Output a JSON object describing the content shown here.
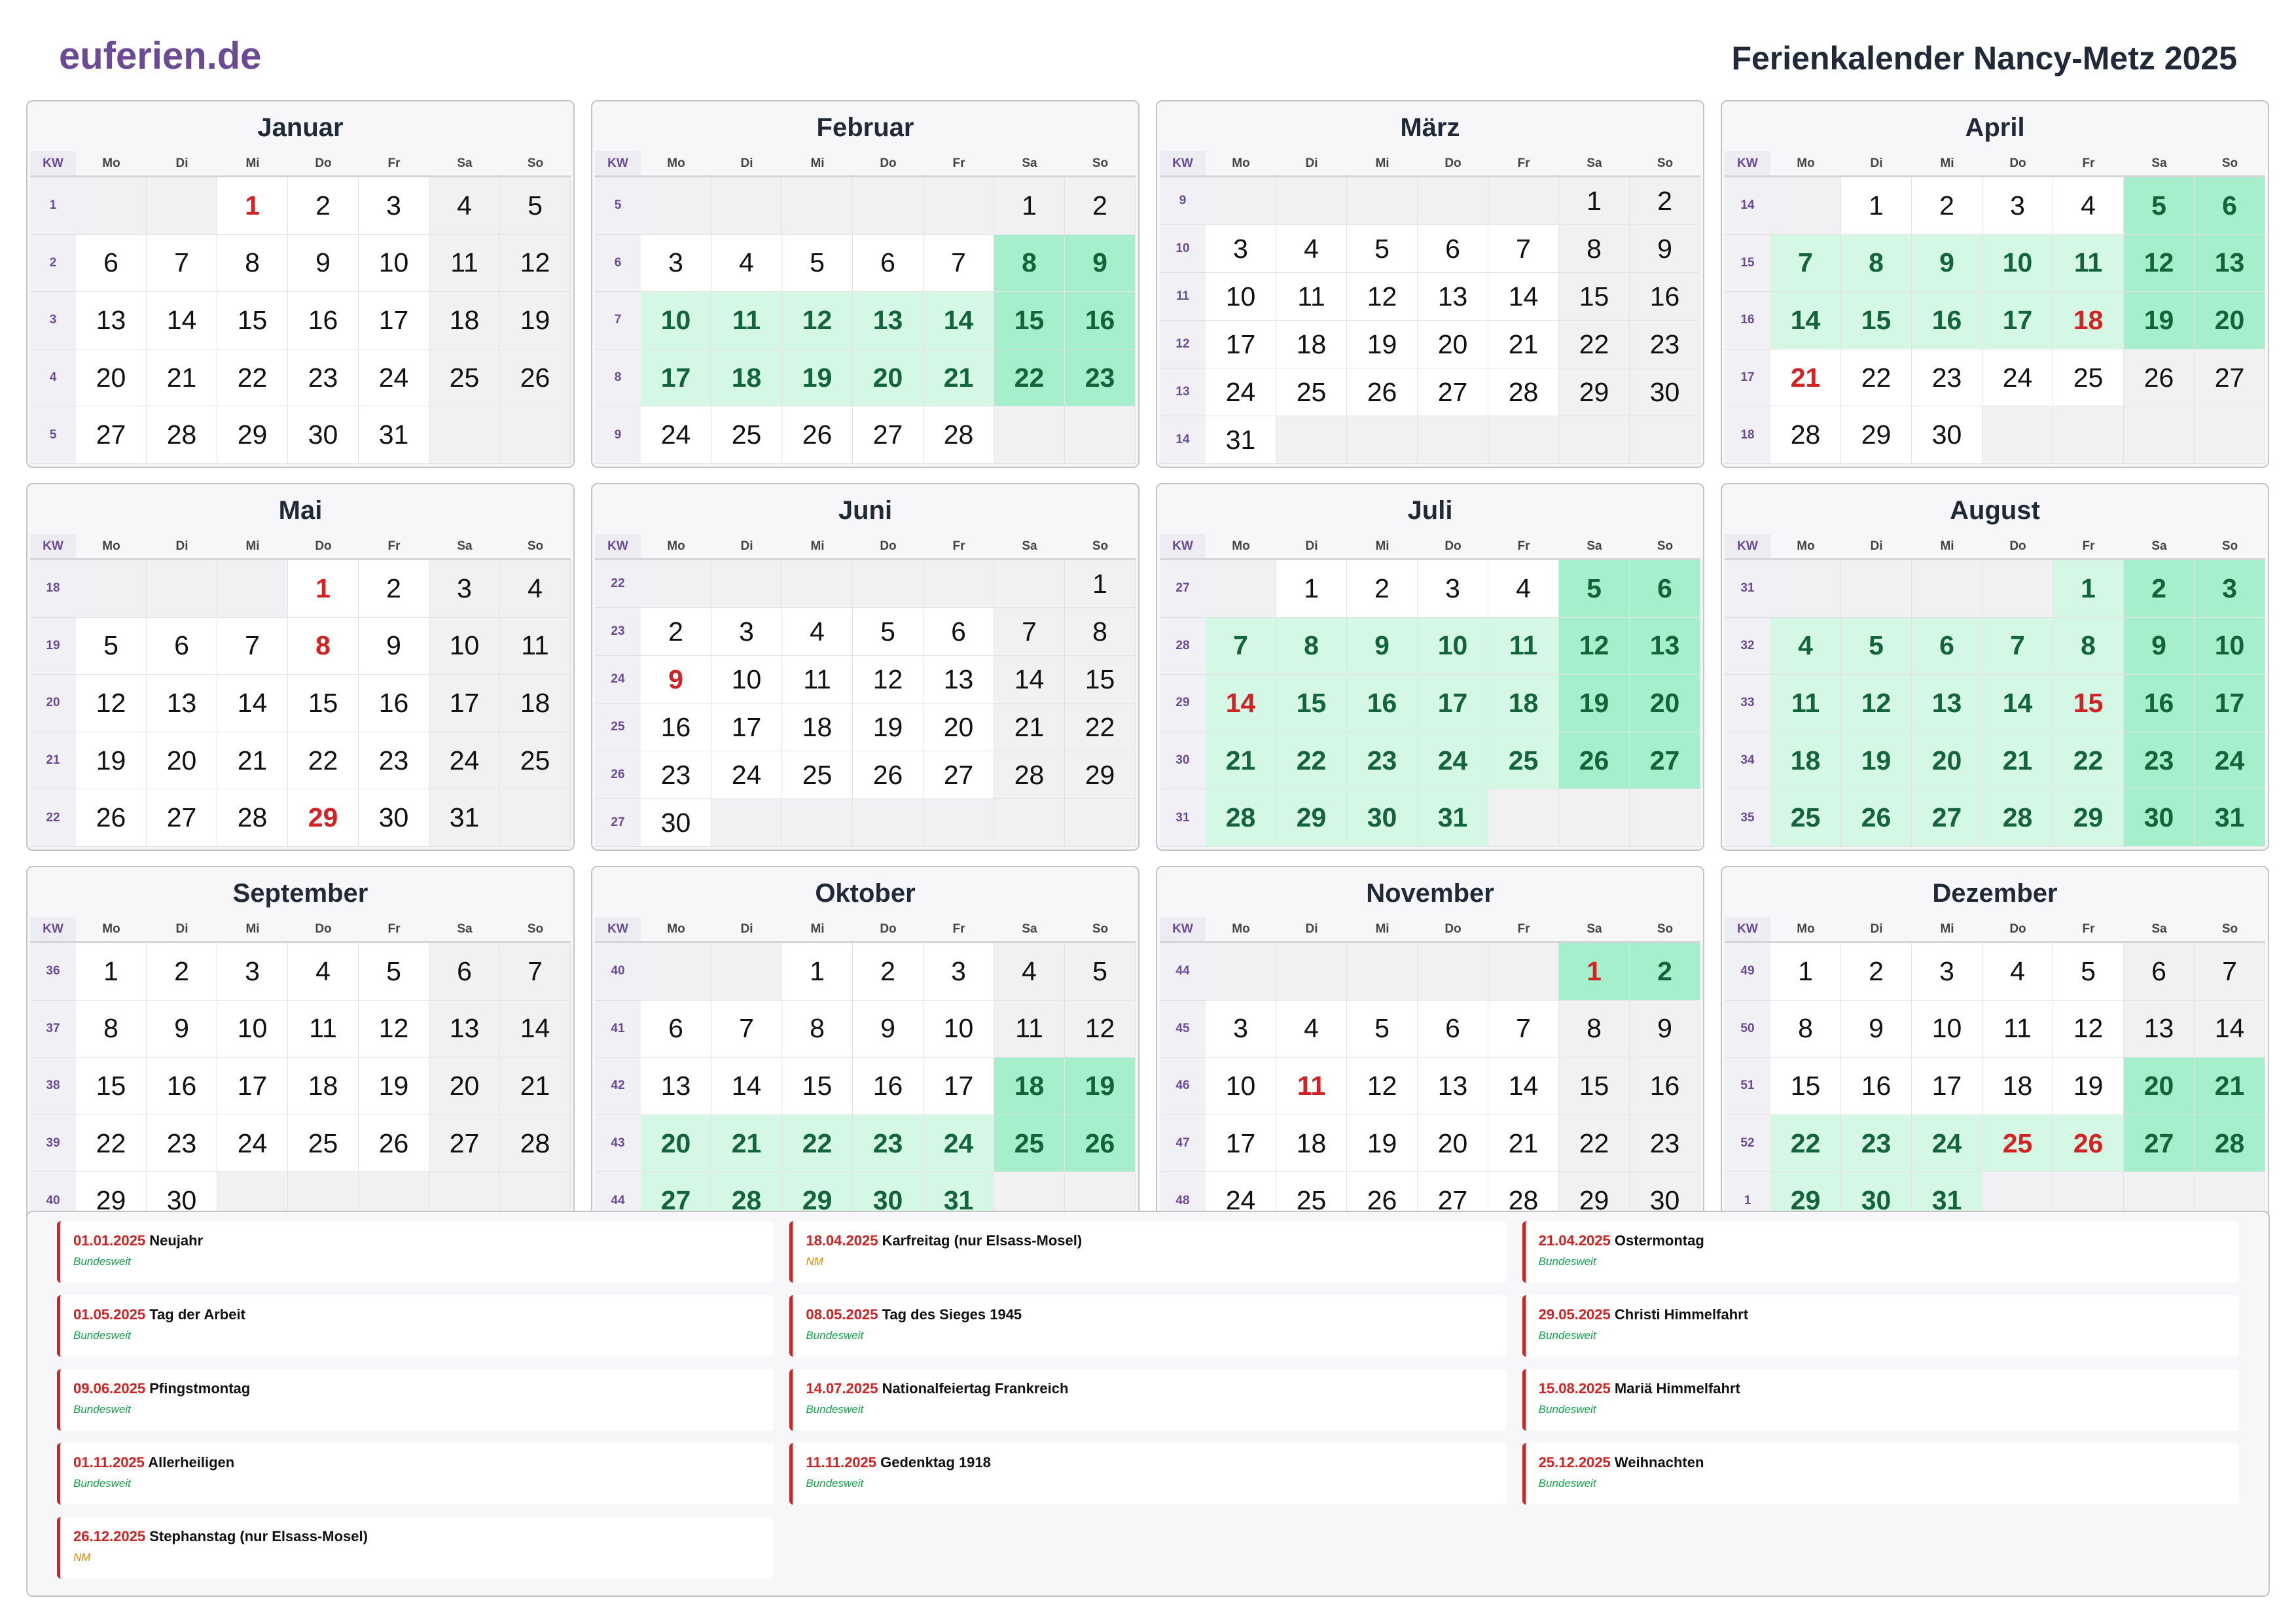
{
  "brand": "euferien.de",
  "title": "Ferienkalender Nancy-Metz 2025",
  "kw_label": "KW",
  "weekdays": [
    "Mo",
    "Di",
    "Mi",
    "Do",
    "Fr",
    "Sa",
    "So"
  ],
  "colors": {
    "vacation": "#d5f7e6",
    "vacation_weekend": "#a6efcc",
    "holiday": "#d42121",
    "brand": "#6b4a95"
  },
  "year": 2025,
  "vacations": [
    {
      "from": "2025-02-08",
      "to": "2025-02-23"
    },
    {
      "from": "2025-04-05",
      "to": "2025-04-20"
    },
    {
      "from": "2025-07-05",
      "to": "2025-08-31"
    },
    {
      "from": "2025-10-18",
      "to": "2025-11-02"
    },
    {
      "from": "2025-12-20",
      "to": "2026-01-04"
    }
  ],
  "months": [
    {
      "name": "Januar",
      "rows": [
        {
          "kw": "1",
          "days": [
            "",
            "",
            "1",
            "2",
            "3",
            "4",
            "5"
          ]
        },
        {
          "kw": "2",
          "days": [
            "6",
            "7",
            "8",
            "9",
            "10",
            "11",
            "12"
          ]
        },
        {
          "kw": "3",
          "days": [
            "13",
            "14",
            "15",
            "16",
            "17",
            "18",
            "19"
          ]
        },
        {
          "kw": "4",
          "days": [
            "20",
            "21",
            "22",
            "23",
            "24",
            "25",
            "26"
          ]
        },
        {
          "kw": "5",
          "days": [
            "27",
            "28",
            "29",
            "30",
            "31",
            "",
            ""
          ]
        }
      ]
    },
    {
      "name": "Februar",
      "rows": [
        {
          "kw": "5",
          "days": [
            "",
            "",
            "",
            "",
            "",
            "1",
            "2"
          ]
        },
        {
          "kw": "6",
          "days": [
            "3",
            "4",
            "5",
            "6",
            "7",
            "8",
            "9"
          ]
        },
        {
          "kw": "7",
          "days": [
            "10",
            "11",
            "12",
            "13",
            "14",
            "15",
            "16"
          ]
        },
        {
          "kw": "8",
          "days": [
            "17",
            "18",
            "19",
            "20",
            "21",
            "22",
            "23"
          ]
        },
        {
          "kw": "9",
          "days": [
            "24",
            "25",
            "26",
            "27",
            "28",
            "",
            ""
          ]
        }
      ]
    },
    {
      "name": "März",
      "rows": [
        {
          "kw": "9",
          "days": [
            "",
            "",
            "",
            "",
            "",
            "1",
            "2"
          ]
        },
        {
          "kw": "10",
          "days": [
            "3",
            "4",
            "5",
            "6",
            "7",
            "8",
            "9"
          ]
        },
        {
          "kw": "11",
          "days": [
            "10",
            "11",
            "12",
            "13",
            "14",
            "15",
            "16"
          ]
        },
        {
          "kw": "12",
          "days": [
            "17",
            "18",
            "19",
            "20",
            "21",
            "22",
            "23"
          ]
        },
        {
          "kw": "13",
          "days": [
            "24",
            "25",
            "26",
            "27",
            "28",
            "29",
            "30"
          ]
        },
        {
          "kw": "14",
          "days": [
            "31",
            "",
            "",
            "",
            "",
            "",
            ""
          ]
        }
      ]
    },
    {
      "name": "April",
      "rows": [
        {
          "kw": "14",
          "days": [
            "",
            "1",
            "2",
            "3",
            "4",
            "5",
            "6"
          ]
        },
        {
          "kw": "15",
          "days": [
            "7",
            "8",
            "9",
            "10",
            "11",
            "12",
            "13"
          ]
        },
        {
          "kw": "16",
          "days": [
            "14",
            "15",
            "16",
            "17",
            "18",
            "19",
            "20"
          ]
        },
        {
          "kw": "17",
          "days": [
            "21",
            "22",
            "23",
            "24",
            "25",
            "26",
            "27"
          ]
        },
        {
          "kw": "18",
          "days": [
            "28",
            "29",
            "30",
            "",
            "",
            "",
            ""
          ]
        }
      ]
    },
    {
      "name": "Mai",
      "rows": [
        {
          "kw": "18",
          "days": [
            "",
            "",
            "",
            "1",
            "2",
            "3",
            "4"
          ]
        },
        {
          "kw": "19",
          "days": [
            "5",
            "6",
            "7",
            "8",
            "9",
            "10",
            "11"
          ]
        },
        {
          "kw": "20",
          "days": [
            "12",
            "13",
            "14",
            "15",
            "16",
            "17",
            "18"
          ]
        },
        {
          "kw": "21",
          "days": [
            "19",
            "20",
            "21",
            "22",
            "23",
            "24",
            "25"
          ]
        },
        {
          "kw": "22",
          "days": [
            "26",
            "27",
            "28",
            "29",
            "30",
            "31",
            ""
          ]
        }
      ]
    },
    {
      "name": "Juni",
      "rows": [
        {
          "kw": "22",
          "days": [
            "",
            "",
            "",
            "",
            "",
            "",
            "1"
          ]
        },
        {
          "kw": "23",
          "days": [
            "2",
            "3",
            "4",
            "5",
            "6",
            "7",
            "8"
          ]
        },
        {
          "kw": "24",
          "days": [
            "9",
            "10",
            "11",
            "12",
            "13",
            "14",
            "15"
          ]
        },
        {
          "kw": "25",
          "days": [
            "16",
            "17",
            "18",
            "19",
            "20",
            "21",
            "22"
          ]
        },
        {
          "kw": "26",
          "days": [
            "23",
            "24",
            "25",
            "26",
            "27",
            "28",
            "29"
          ]
        },
        {
          "kw": "27",
          "days": [
            "30",
            "",
            "",
            "",
            "",
            "",
            ""
          ]
        }
      ]
    },
    {
      "name": "Juli",
      "rows": [
        {
          "kw": "27",
          "days": [
            "",
            "1",
            "2",
            "3",
            "4",
            "5",
            "6"
          ]
        },
        {
          "kw": "28",
          "days": [
            "7",
            "8",
            "9",
            "10",
            "11",
            "12",
            "13"
          ]
        },
        {
          "kw": "29",
          "days": [
            "14",
            "15",
            "16",
            "17",
            "18",
            "19",
            "20"
          ]
        },
        {
          "kw": "30",
          "days": [
            "21",
            "22",
            "23",
            "24",
            "25",
            "26",
            "27"
          ]
        },
        {
          "kw": "31",
          "days": [
            "28",
            "29",
            "30",
            "31",
            "",
            "",
            ""
          ]
        }
      ]
    },
    {
      "name": "August",
      "rows": [
        {
          "kw": "31",
          "days": [
            "",
            "",
            "",
            "",
            "1",
            "2",
            "3"
          ]
        },
        {
          "kw": "32",
          "days": [
            "4",
            "5",
            "6",
            "7",
            "8",
            "9",
            "10"
          ]
        },
        {
          "kw": "33",
          "days": [
            "11",
            "12",
            "13",
            "14",
            "15",
            "16",
            "17"
          ]
        },
        {
          "kw": "34",
          "days": [
            "18",
            "19",
            "20",
            "21",
            "22",
            "23",
            "24"
          ]
        },
        {
          "kw": "35",
          "days": [
            "25",
            "26",
            "27",
            "28",
            "29",
            "30",
            "31"
          ]
        }
      ]
    },
    {
      "name": "September",
      "rows": [
        {
          "kw": "36",
          "days": [
            "1",
            "2",
            "3",
            "4",
            "5",
            "6",
            "7"
          ]
        },
        {
          "kw": "37",
          "days": [
            "8",
            "9",
            "10",
            "11",
            "12",
            "13",
            "14"
          ]
        },
        {
          "kw": "38",
          "days": [
            "15",
            "16",
            "17",
            "18",
            "19",
            "20",
            "21"
          ]
        },
        {
          "kw": "39",
          "days": [
            "22",
            "23",
            "24",
            "25",
            "26",
            "27",
            "28"
          ]
        },
        {
          "kw": "40",
          "days": [
            "29",
            "30",
            "",
            "",
            "",
            "",
            ""
          ]
        }
      ]
    },
    {
      "name": "Oktober",
      "rows": [
        {
          "kw": "40",
          "days": [
            "",
            "",
            "1",
            "2",
            "3",
            "4",
            "5"
          ]
        },
        {
          "kw": "41",
          "days": [
            "6",
            "7",
            "8",
            "9",
            "10",
            "11",
            "12"
          ]
        },
        {
          "kw": "42",
          "days": [
            "13",
            "14",
            "15",
            "16",
            "17",
            "18",
            "19"
          ]
        },
        {
          "kw": "43",
          "days": [
            "20",
            "21",
            "22",
            "23",
            "24",
            "25",
            "26"
          ]
        },
        {
          "kw": "44",
          "days": [
            "27",
            "28",
            "29",
            "30",
            "31",
            "",
            ""
          ]
        }
      ]
    },
    {
      "name": "November",
      "rows": [
        {
          "kw": "44",
          "days": [
            "",
            "",
            "",
            "",
            "",
            "1",
            "2"
          ]
        },
        {
          "kw": "45",
          "days": [
            "3",
            "4",
            "5",
            "6",
            "7",
            "8",
            "9"
          ]
        },
        {
          "kw": "46",
          "days": [
            "10",
            "11",
            "12",
            "13",
            "14",
            "15",
            "16"
          ]
        },
        {
          "kw": "47",
          "days": [
            "17",
            "18",
            "19",
            "20",
            "21",
            "22",
            "23"
          ]
        },
        {
          "kw": "48",
          "days": [
            "24",
            "25",
            "26",
            "27",
            "28",
            "29",
            "30"
          ]
        }
      ]
    },
    {
      "name": "Dezember",
      "rows": [
        {
          "kw": "49",
          "days": [
            "1",
            "2",
            "3",
            "4",
            "5",
            "6",
            "7"
          ]
        },
        {
          "kw": "50",
          "days": [
            "8",
            "9",
            "10",
            "11",
            "12",
            "13",
            "14"
          ]
        },
        {
          "kw": "51",
          "days": [
            "15",
            "16",
            "17",
            "18",
            "19",
            "20",
            "21"
          ]
        },
        {
          "kw": "52",
          "days": [
            "22",
            "23",
            "24",
            "25",
            "26",
            "27",
            "28"
          ]
        },
        {
          "kw": "1",
          "days": [
            "29",
            "30",
            "31",
            "",
            "",
            "",
            ""
          ]
        }
      ]
    }
  ],
  "holidays": [
    {
      "date": "01.01.2025",
      "name": "Neujahr",
      "scope": "Bundesweit"
    },
    {
      "date": "18.04.2025",
      "name": "Karfreitag (nur Elsass-Mosel)",
      "scope": "NM"
    },
    {
      "date": "21.04.2025",
      "name": "Ostermontag",
      "scope": "Bundesweit"
    },
    {
      "date": "01.05.2025",
      "name": "Tag der Arbeit",
      "scope": "Bundesweit"
    },
    {
      "date": "08.05.2025",
      "name": "Tag des Sieges 1945",
      "scope": "Bundesweit"
    },
    {
      "date": "29.05.2025",
      "name": "Christi Himmelfahrt",
      "scope": "Bundesweit"
    },
    {
      "date": "09.06.2025",
      "name": "Pfingstmontag",
      "scope": "Bundesweit"
    },
    {
      "date": "14.07.2025",
      "name": "Nationalfeiertag Frankreich",
      "scope": "Bundesweit"
    },
    {
      "date": "15.08.2025",
      "name": "Mariä Himmelfahrt",
      "scope": "Bundesweit"
    },
    {
      "date": "01.11.2025",
      "name": "Allerheiligen",
      "scope": "Bundesweit"
    },
    {
      "date": "11.11.2025",
      "name": "Gedenktag 1918",
      "scope": "Bundesweit"
    },
    {
      "date": "25.12.2025",
      "name": "Weihnachten",
      "scope": "Bundesweit"
    },
    {
      "date": "26.12.2025",
      "name": "Stephanstag (nur Elsass-Mosel)",
      "scope": "NM"
    }
  ]
}
